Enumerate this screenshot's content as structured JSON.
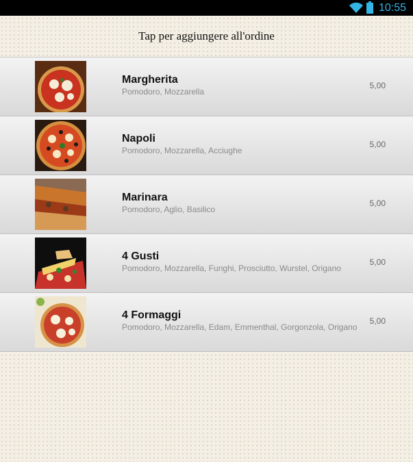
{
  "status_bar": {
    "time": "10:55"
  },
  "header": {
    "title": "Tap per aggiungere all'ordine"
  },
  "menu": {
    "items": [
      {
        "name": "Margherita",
        "ingredients": "Pomodoro, Mozzarella",
        "price": "5,00"
      },
      {
        "name": "Napoli",
        "ingredients": "Pomodoro, Mozzarella, Acciughe",
        "price": "5,00"
      },
      {
        "name": "Marinara",
        "ingredients": "Pomodoro, Aglio, Basilico",
        "price": "5,00"
      },
      {
        "name": "4 Gusti",
        "ingredients": "Pomodoro, Mozzarella, Funghi, Prosciutto, Wurstel, Origano",
        "price": "5,00"
      },
      {
        "name": "4 Formaggi",
        "ingredients": "Pomodoro, Mozzarella, Edam, Emmenthal, Gorgonzola, Origano",
        "price": "5,00"
      }
    ]
  }
}
